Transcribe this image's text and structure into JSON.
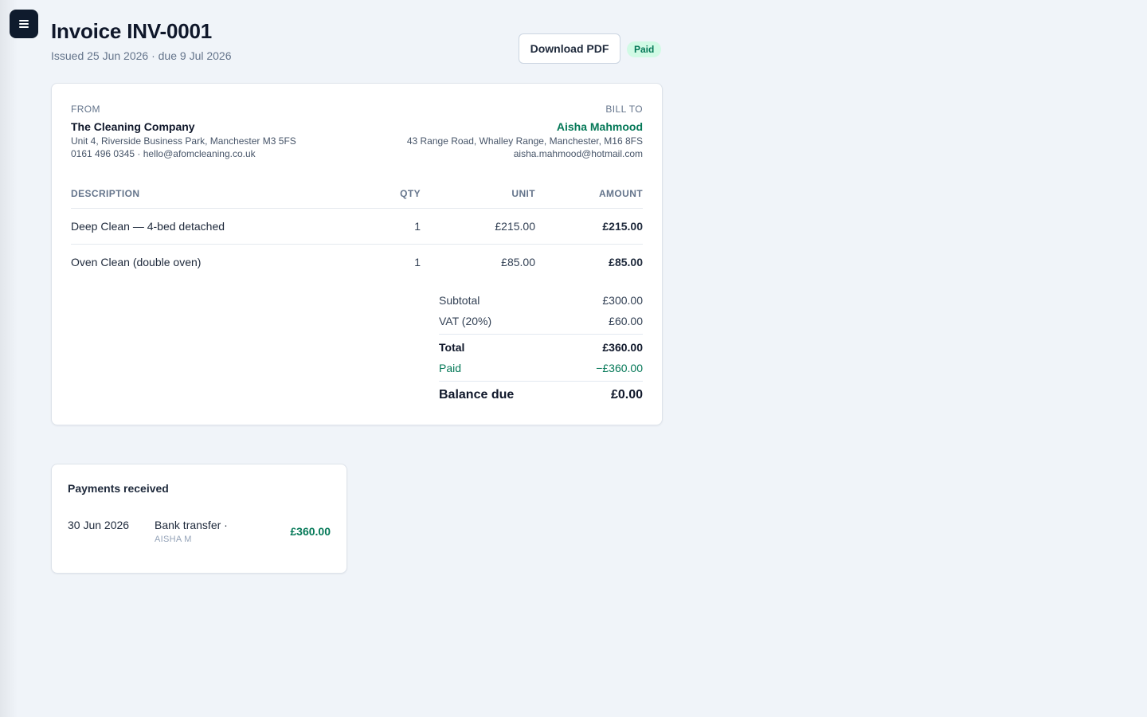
{
  "header": {
    "title": "Invoice INV-0001",
    "subtitle": "Issued 25 Jun 2026 · due 9 Jul 2026",
    "download_label": "Download PDF",
    "status": "Paid"
  },
  "from": {
    "label": "FROM",
    "name": "The Cleaning Company",
    "address": "Unit 4, Riverside Business Park, Manchester M3 5FS",
    "contact": "0161 496 0345 · hello@afomcleaning.co.uk"
  },
  "bill_to": {
    "label": "BILL TO",
    "name": "Aisha Mahmood",
    "address": "43 Range Road, Whalley Range, Manchester, M16 8FS",
    "email": "aisha.mahmood@hotmail.com"
  },
  "table": {
    "columns": [
      "DESCRIPTION",
      "QTY",
      "UNIT",
      "AMOUNT"
    ],
    "rows": [
      {
        "description": "Deep Clean — 4-bed detached",
        "qty": "1",
        "unit": "£215.00",
        "amount": "£215.00"
      },
      {
        "description": "Oven Clean (double oven)",
        "qty": "1",
        "unit": "£85.00",
        "amount": "£85.00"
      }
    ]
  },
  "totals": {
    "subtotal_label": "Subtotal",
    "subtotal": "£300.00",
    "vat_label": "VAT (20%)",
    "vat": "£60.00",
    "total_label": "Total",
    "total": "£360.00",
    "paid_label": "Paid",
    "paid": "−£360.00",
    "balance_label": "Balance due",
    "balance": "£0.00"
  },
  "payments": {
    "title": "Payments received",
    "items": [
      {
        "date": "30 Jun 2026",
        "method": "Bank transfer ·",
        "reference": "AISHA M",
        "amount": "£360.00"
      }
    ]
  },
  "colors": {
    "accent_green": "#047857",
    "badge_bg": "#d1fae5",
    "menu_button": "#0f1b2d",
    "page_bg": "#f0f4f9"
  },
  "icons": {
    "menu": "hamburger-menu-icon"
  }
}
